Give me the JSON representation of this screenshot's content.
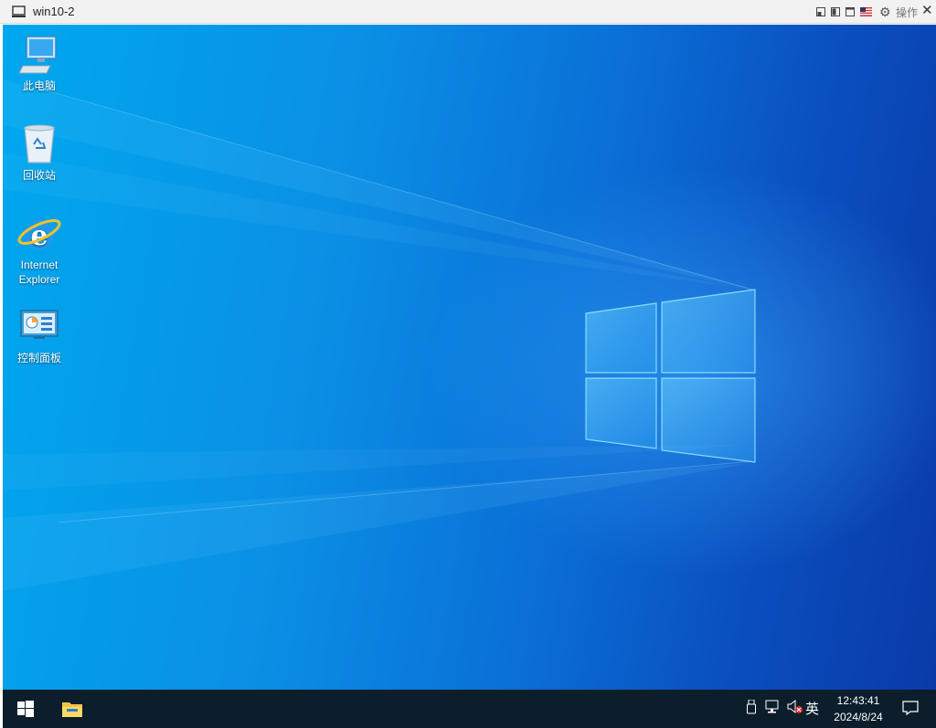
{
  "window": {
    "title": "win10-2",
    "actions_label": "操作",
    "keyboard_flag": "us-flag-icon"
  },
  "desktop": {
    "icons": [
      {
        "label": "此电脑",
        "icon": "computer-icon"
      },
      {
        "label": "回收站",
        "icon": "recycle-bin-icon"
      },
      {
        "label_line1": "Internet",
        "label_line2": "Explorer",
        "icon": "internet-explorer-icon"
      },
      {
        "label": "控制面板",
        "icon": "control-panel-icon"
      }
    ],
    "wallpaper_colors": {
      "light": "#00a8ef",
      "dark": "#0a3aa8"
    }
  },
  "taskbar": {
    "background": "#0c1e2b",
    "input_method": "英",
    "time": "12:43:41",
    "date": "2024/8/24"
  }
}
